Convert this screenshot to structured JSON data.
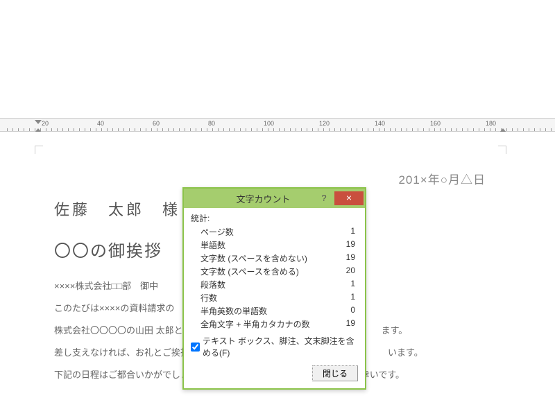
{
  "ruler": {
    "marks": [
      "20",
      "40",
      "60",
      "80",
      "100",
      "120",
      "140",
      "160",
      "180"
    ]
  },
  "document": {
    "date": "201×年○月△日",
    "addressee": "佐藤　太郎　様",
    "subject": "〇〇の御挨拶",
    "body": [
      "××××株式会社□□部　御中",
      "このたびは××××の資料請求の",
      "株式会社〇〇〇〇の山田 太郎と　　　　　　　　　　　　　　　　　　　　　　ます。",
      "差し支えなければ、お礼とご挨拶　　　　　　　　　　　　　　　　　　　　　　います。",
      "下記の日程はご都合いかがでしょうか。お時間は１０分ほどいただけますと幸いです。"
    ]
  },
  "dialog": {
    "title": "文字カウント",
    "help": "?",
    "close_x": "×",
    "stats_label": "統計:",
    "rows": [
      {
        "label": "ページ数",
        "value": "1"
      },
      {
        "label": "単語数",
        "value": "19"
      },
      {
        "label": "文字数 (スペースを含めない)",
        "value": "19"
      },
      {
        "label": "文字数 (スペースを含める)",
        "value": "20"
      },
      {
        "label": "段落数",
        "value": "1"
      },
      {
        "label": "行数",
        "value": "1"
      },
      {
        "label": "半角英数の単語数",
        "value": "0"
      },
      {
        "label": "全角文字 + 半角カタカナの数",
        "value": "19"
      }
    ],
    "checkbox_label": "テキスト ボックス、脚注、文末脚注を含める(F)",
    "close_button": "閉じる"
  }
}
